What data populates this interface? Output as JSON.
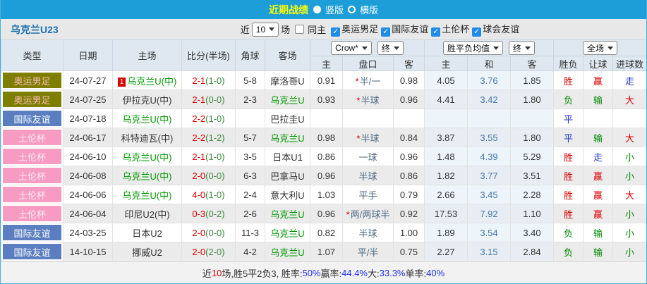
{
  "header": {
    "title": "近期战绩",
    "radio_vertical": "竖版",
    "radio_horizontal": "横版"
  },
  "filter": {
    "team": "乌克兰U23",
    "recent_label": "近",
    "recent_count": "10",
    "matches_label": "场",
    "same_home_label": "同主",
    "checkboxes": [
      {
        "label": "奥运男足",
        "checked": true
      },
      {
        "label": "国际友谊",
        "checked": true
      },
      {
        "label": "土伦杯",
        "checked": true
      },
      {
        "label": "球会友谊",
        "checked": true
      }
    ]
  },
  "table": {
    "selects": {
      "company": "Crow*",
      "time1": "终",
      "avg": "胜平负均值",
      "time2": "终",
      "scope": "全场"
    },
    "col_headers": [
      "类型",
      "日期",
      "主场",
      "比分(半场)",
      "角球",
      "客场"
    ],
    "sub_headers": [
      "主",
      "盘口",
      "客",
      "主",
      "和",
      "客",
      "胜负",
      "让球",
      "进球数"
    ],
    "rows": [
      {
        "type": "奥运男足",
        "type_key": "olympic",
        "date": "24-07-27",
        "home": {
          "name": "乌克兰U(中)",
          "green": true,
          "badge": "1"
        },
        "score": "2-1",
        "half": "(1-0)",
        "corner": "5-8",
        "away": {
          "name": "摩洛哥U",
          "green": false
        },
        "odds_home": "0.91",
        "handicap": {
          "star": true,
          "text": "半/一"
        },
        "odds_away": "0.98",
        "avg_home": "4.05",
        "avg_draw": "3.76",
        "avg_away": "1.85",
        "result": {
          "text": "胜",
          "color": "win"
        },
        "let_result": {
          "text": "赢",
          "color": "win"
        },
        "goals": {
          "text": "走",
          "color": "draw"
        }
      },
      {
        "type": "奥运男足",
        "type_key": "olympic",
        "date": "24-07-25",
        "home": {
          "name": "伊拉克U(中)",
          "green": false,
          "badge": ""
        },
        "score": "2-1",
        "half": "(0-0)",
        "corner": "2-3",
        "away": {
          "name": "乌克兰U",
          "green": true
        },
        "odds_home": "0.93",
        "handicap": {
          "star": true,
          "text": "半球"
        },
        "odds_away": "0.96",
        "avg_home": "4.41",
        "avg_draw": "3.42",
        "avg_away": "1.80",
        "result": {
          "text": "负",
          "color": "lose"
        },
        "let_result": {
          "text": "输",
          "color": "lose"
        },
        "goals": {
          "text": "大",
          "color": "win"
        }
      },
      {
        "type": "国际友谊",
        "type_key": "friendly",
        "date": "24-07-18",
        "home": {
          "name": "乌克兰U(中)",
          "green": true,
          "badge": ""
        },
        "score": "2-2",
        "half": "(1-0)",
        "corner": "",
        "away": {
          "name": "巴拉圭U",
          "green": false
        },
        "odds_home": "",
        "handicap": {
          "star": false,
          "text": ""
        },
        "odds_away": "",
        "avg_home": "",
        "avg_draw": "",
        "avg_away": "",
        "result": {
          "text": "平",
          "color": "draw"
        },
        "let_result": {
          "text": "",
          "color": "draw"
        },
        "goals": {
          "text": "",
          "color": "draw"
        }
      },
      {
        "type": "土伦杯",
        "type_key": "toulon",
        "date": "24-06-17",
        "home": {
          "name": "科特迪瓦(中)",
          "green": false,
          "badge": ""
        },
        "score": "2-2",
        "half": "(1-2)",
        "corner": "5-7",
        "away": {
          "name": "乌克兰U",
          "green": true
        },
        "odds_home": "0.98",
        "handicap": {
          "star": true,
          "text": "半球"
        },
        "odds_away": "0.84",
        "avg_home": "3.87",
        "avg_draw": "3.55",
        "avg_away": "1.80",
        "result": {
          "text": "平",
          "color": "draw"
        },
        "let_result": {
          "text": "输",
          "color": "lose"
        },
        "goals": {
          "text": "大",
          "color": "win"
        }
      },
      {
        "type": "土伦杯",
        "type_key": "toulon",
        "date": "24-06-10",
        "home": {
          "name": "乌克兰U(中)",
          "green": true,
          "badge": ""
        },
        "score": "2-1",
        "half": "(1-0)",
        "corner": "3-5",
        "away": {
          "name": "日本U1",
          "green": false
        },
        "odds_home": "0.86",
        "handicap": {
          "star": false,
          "text": "一球"
        },
        "odds_away": "0.96",
        "avg_home": "1.48",
        "avg_draw": "4.39",
        "avg_away": "5.29",
        "result": {
          "text": "胜",
          "color": "win"
        },
        "let_result": {
          "text": "走",
          "color": "draw"
        },
        "goals": {
          "text": "小",
          "color": "lose"
        }
      },
      {
        "type": "土伦杯",
        "type_key": "toulon",
        "date": "24-06-08",
        "home": {
          "name": "乌克兰U(中)",
          "green": true,
          "badge": ""
        },
        "score": "2-0",
        "half": "(0-0)",
        "corner": "6-3",
        "away": {
          "name": "巴拿马U",
          "green": false
        },
        "odds_home": "0.96",
        "handicap": {
          "star": false,
          "text": "半球"
        },
        "odds_away": "0.86",
        "avg_home": "1.82",
        "avg_draw": "3.77",
        "avg_away": "3.51",
        "result": {
          "text": "胜",
          "color": "win"
        },
        "let_result": {
          "text": "赢",
          "color": "win"
        },
        "goals": {
          "text": "小",
          "color": "lose"
        }
      },
      {
        "type": "土伦杯",
        "type_key": "toulon",
        "date": "24-06-06",
        "home": {
          "name": "乌克兰U(中)",
          "green": true,
          "badge": ""
        },
        "score": "4-0",
        "half": "(1-0)",
        "corner": "2-4",
        "away": {
          "name": "意大利U",
          "green": false
        },
        "odds_home": "1.03",
        "handicap": {
          "star": false,
          "text": "平手"
        },
        "odds_away": "0.79",
        "avg_home": "2.66",
        "avg_draw": "3.45",
        "avg_away": "2.28",
        "result": {
          "text": "胜",
          "color": "win"
        },
        "let_result": {
          "text": "赢",
          "color": "win"
        },
        "goals": {
          "text": "大",
          "color": "win"
        }
      },
      {
        "type": "土伦杯",
        "type_key": "toulon",
        "date": "24-06-04",
        "home": {
          "name": "印尼U2(中)",
          "green": false,
          "badge": ""
        },
        "score": "0-3",
        "half": "(0-2)",
        "corner": "2-6",
        "away": {
          "name": "乌克兰U",
          "green": true
        },
        "odds_home": "0.96",
        "handicap": {
          "star": true,
          "text": "两/两球半"
        },
        "odds_away": "0.92",
        "avg_home": "17.53",
        "avg_draw": "7.92",
        "avg_away": "1.10",
        "result": {
          "text": "胜",
          "color": "win"
        },
        "let_result": {
          "text": "赢",
          "color": "win"
        },
        "goals": {
          "text": "小",
          "color": "lose"
        }
      },
      {
        "type": "国际友谊",
        "type_key": "friendly",
        "date": "24-03-25",
        "home": {
          "name": "日本U2",
          "green": false,
          "badge": ""
        },
        "score": "2-0",
        "half": "(0-0)",
        "corner": "11-3",
        "away": {
          "name": "乌克兰U",
          "green": true
        },
        "odds_home": "0.82",
        "handicap": {
          "star": false,
          "text": "半球"
        },
        "odds_away": "1.00",
        "avg_home": "1.89",
        "avg_draw": "3.54",
        "avg_away": "3.40",
        "result": {
          "text": "负",
          "color": "lose"
        },
        "let_result": {
          "text": "输",
          "color": "lose"
        },
        "goals": {
          "text": "小",
          "color": "lose"
        }
      },
      {
        "type": "国际友谊",
        "type_key": "friendly",
        "date": "14-10-15",
        "home": {
          "name": "挪威U2",
          "green": false,
          "badge": ""
        },
        "score": "2-0",
        "half": "(2-0)",
        "corner": "4-2",
        "away": {
          "name": "乌克兰U",
          "green": true
        },
        "odds_home": "1.07",
        "handicap": {
          "star": false,
          "text": "平/半"
        },
        "odds_away": "0.75",
        "avg_home": "2.27",
        "avg_draw": "3.15",
        "avg_away": "2.84",
        "result": {
          "text": "负",
          "color": "lose"
        },
        "let_result": {
          "text": "输",
          "color": "lose"
        },
        "goals": {
          "text": "小",
          "color": "lose"
        }
      }
    ]
  },
  "summary": {
    "segments": [
      {
        "text": "近",
        "color": "dark"
      },
      {
        "text": "10",
        "color": "red"
      },
      {
        "text": "场,胜5平2负3, 胜率:",
        "color": "dark"
      },
      {
        "text": "50%",
        "color": "blue"
      },
      {
        "text": " 赢率:",
        "color": "dark"
      },
      {
        "text": "44.4%",
        "color": "blue"
      },
      {
        "text": " 大:",
        "color": "dark"
      },
      {
        "text": "33.3%",
        "color": "blue"
      },
      {
        "text": " 单率:",
        "color": "dark"
      },
      {
        "text": "40%",
        "color": "blue"
      }
    ]
  }
}
